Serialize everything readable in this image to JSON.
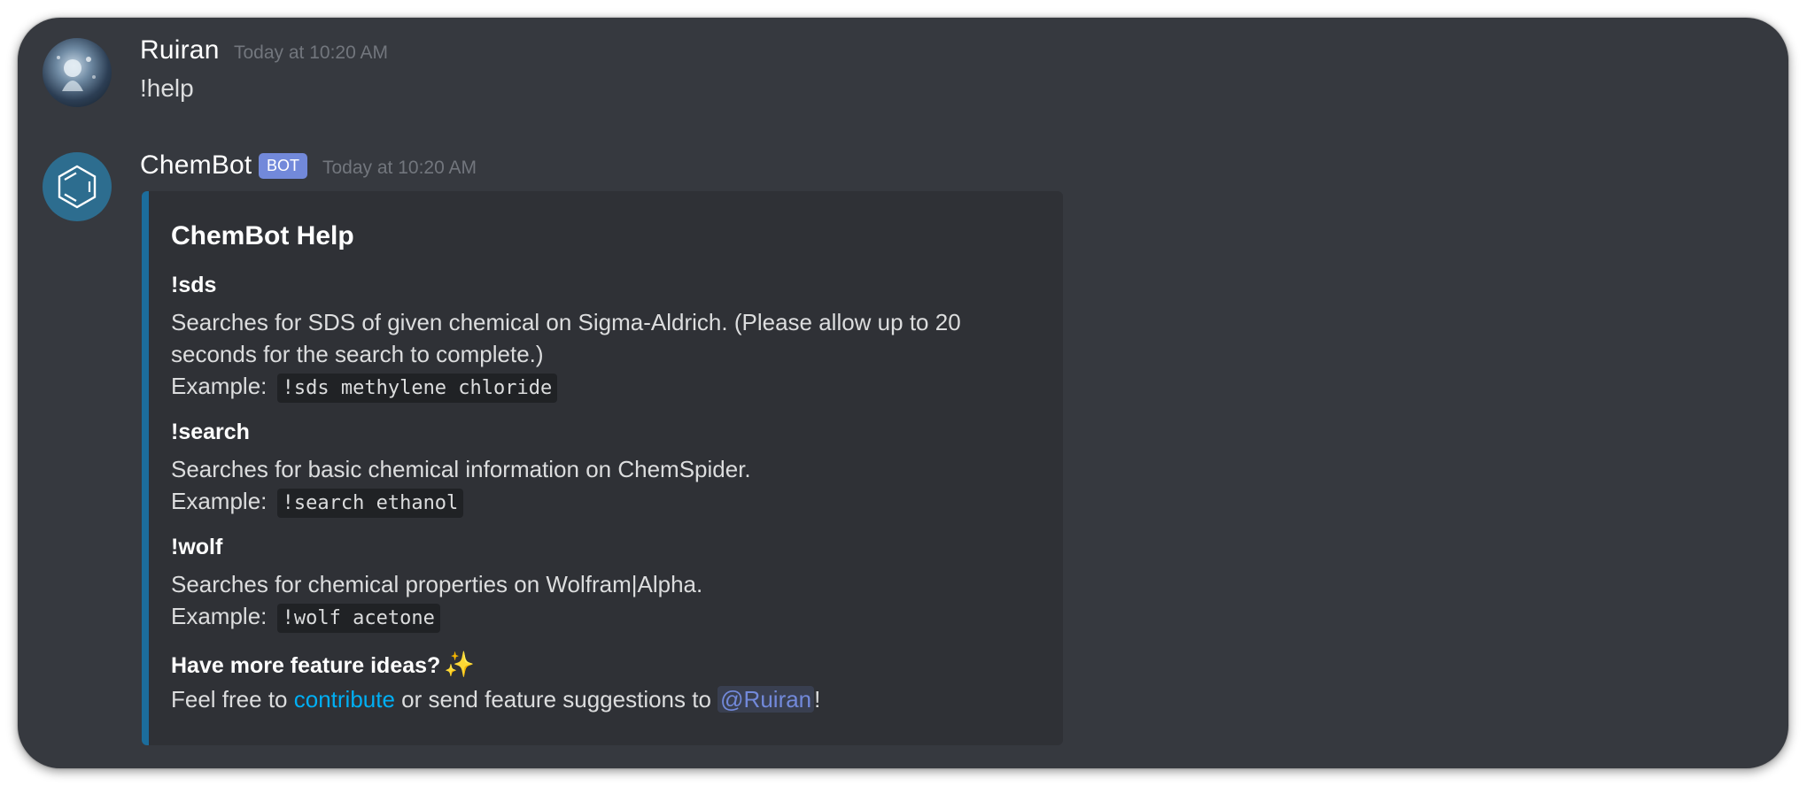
{
  "messages": [
    {
      "author": "Ruiran",
      "timestamp": "Today at 10:20 AM",
      "content": "!help"
    },
    {
      "author": "ChemBot",
      "tag": "BOT",
      "timestamp": "Today at 10:20 AM"
    }
  ],
  "embed": {
    "title": "ChemBot Help",
    "fields": [
      {
        "name": "!sds",
        "line1": "Searches for SDS of given chemical on Sigma-Aldrich. (Please allow up to 20",
        "line2": "seconds for the search to complete.)",
        "example_label": "Example:",
        "example_code": "!sds methylene chloride"
      },
      {
        "name": "!search",
        "line1": "Searches for basic chemical information on ChemSpider.",
        "example_label": "Example:",
        "example_code": "!search ethanol"
      },
      {
        "name": "!wolf",
        "line1": "Searches for chemical properties on Wolfram|Alpha.",
        "example_label": "Example:",
        "example_code": "!wolf acetone"
      }
    ],
    "footer": {
      "name": "Have more feature ideas?",
      "icon": "sparkles-icon",
      "text_before": "Feel free to ",
      "link": "contribute",
      "text_middle": " or send feature suggestions to ",
      "mention": "@Ruiran",
      "text_after": "!"
    }
  },
  "colors": {
    "background": "#36393f",
    "embed_background": "#2f3136",
    "embed_accent": "#1c6d9c",
    "bot_tag": "#7289da",
    "link": "#00aff4",
    "mention": "#7289da"
  }
}
